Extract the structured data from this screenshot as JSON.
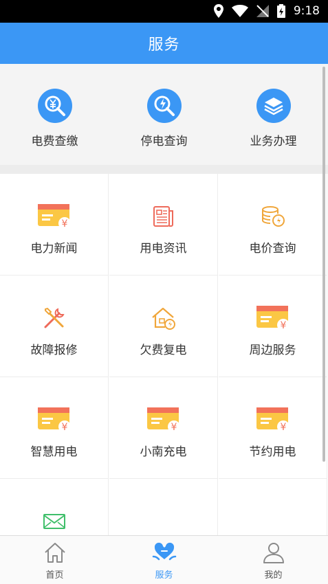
{
  "status": {
    "time": "9:18"
  },
  "header": {
    "title": "服务"
  },
  "top_services": [
    {
      "label": "电费查缴",
      "icon": "yuan-search-icon"
    },
    {
      "label": "停电查询",
      "icon": "lightning-search-icon"
    },
    {
      "label": "业务办理",
      "icon": "layers-icon"
    }
  ],
  "grid_services": [
    {
      "label": "电力新闻",
      "icon": "card-yuan-icon"
    },
    {
      "label": "用电资讯",
      "icon": "document-icon"
    },
    {
      "label": "电价查询",
      "icon": "coins-icon"
    },
    {
      "label": "故障报修",
      "icon": "tools-icon"
    },
    {
      "label": "欠费复电",
      "icon": "house-power-icon"
    },
    {
      "label": "周边服务",
      "icon": "card-yuan-icon"
    },
    {
      "label": "智慧用电",
      "icon": "card-yuan-icon"
    },
    {
      "label": "小南充电",
      "icon": "card-yuan-icon"
    },
    {
      "label": "节约用电",
      "icon": "card-yuan-icon"
    },
    {
      "label": "",
      "icon": "mail-icon"
    }
  ],
  "tabs": [
    {
      "label": "首页",
      "icon": "home-icon"
    },
    {
      "label": "服务",
      "icon": "service-heart-icon"
    },
    {
      "label": "我的",
      "icon": "user-icon"
    }
  ],
  "colors": {
    "primary": "#3b97f5",
    "card_yellow": "#fbc744",
    "card_red": "#f2725a"
  }
}
